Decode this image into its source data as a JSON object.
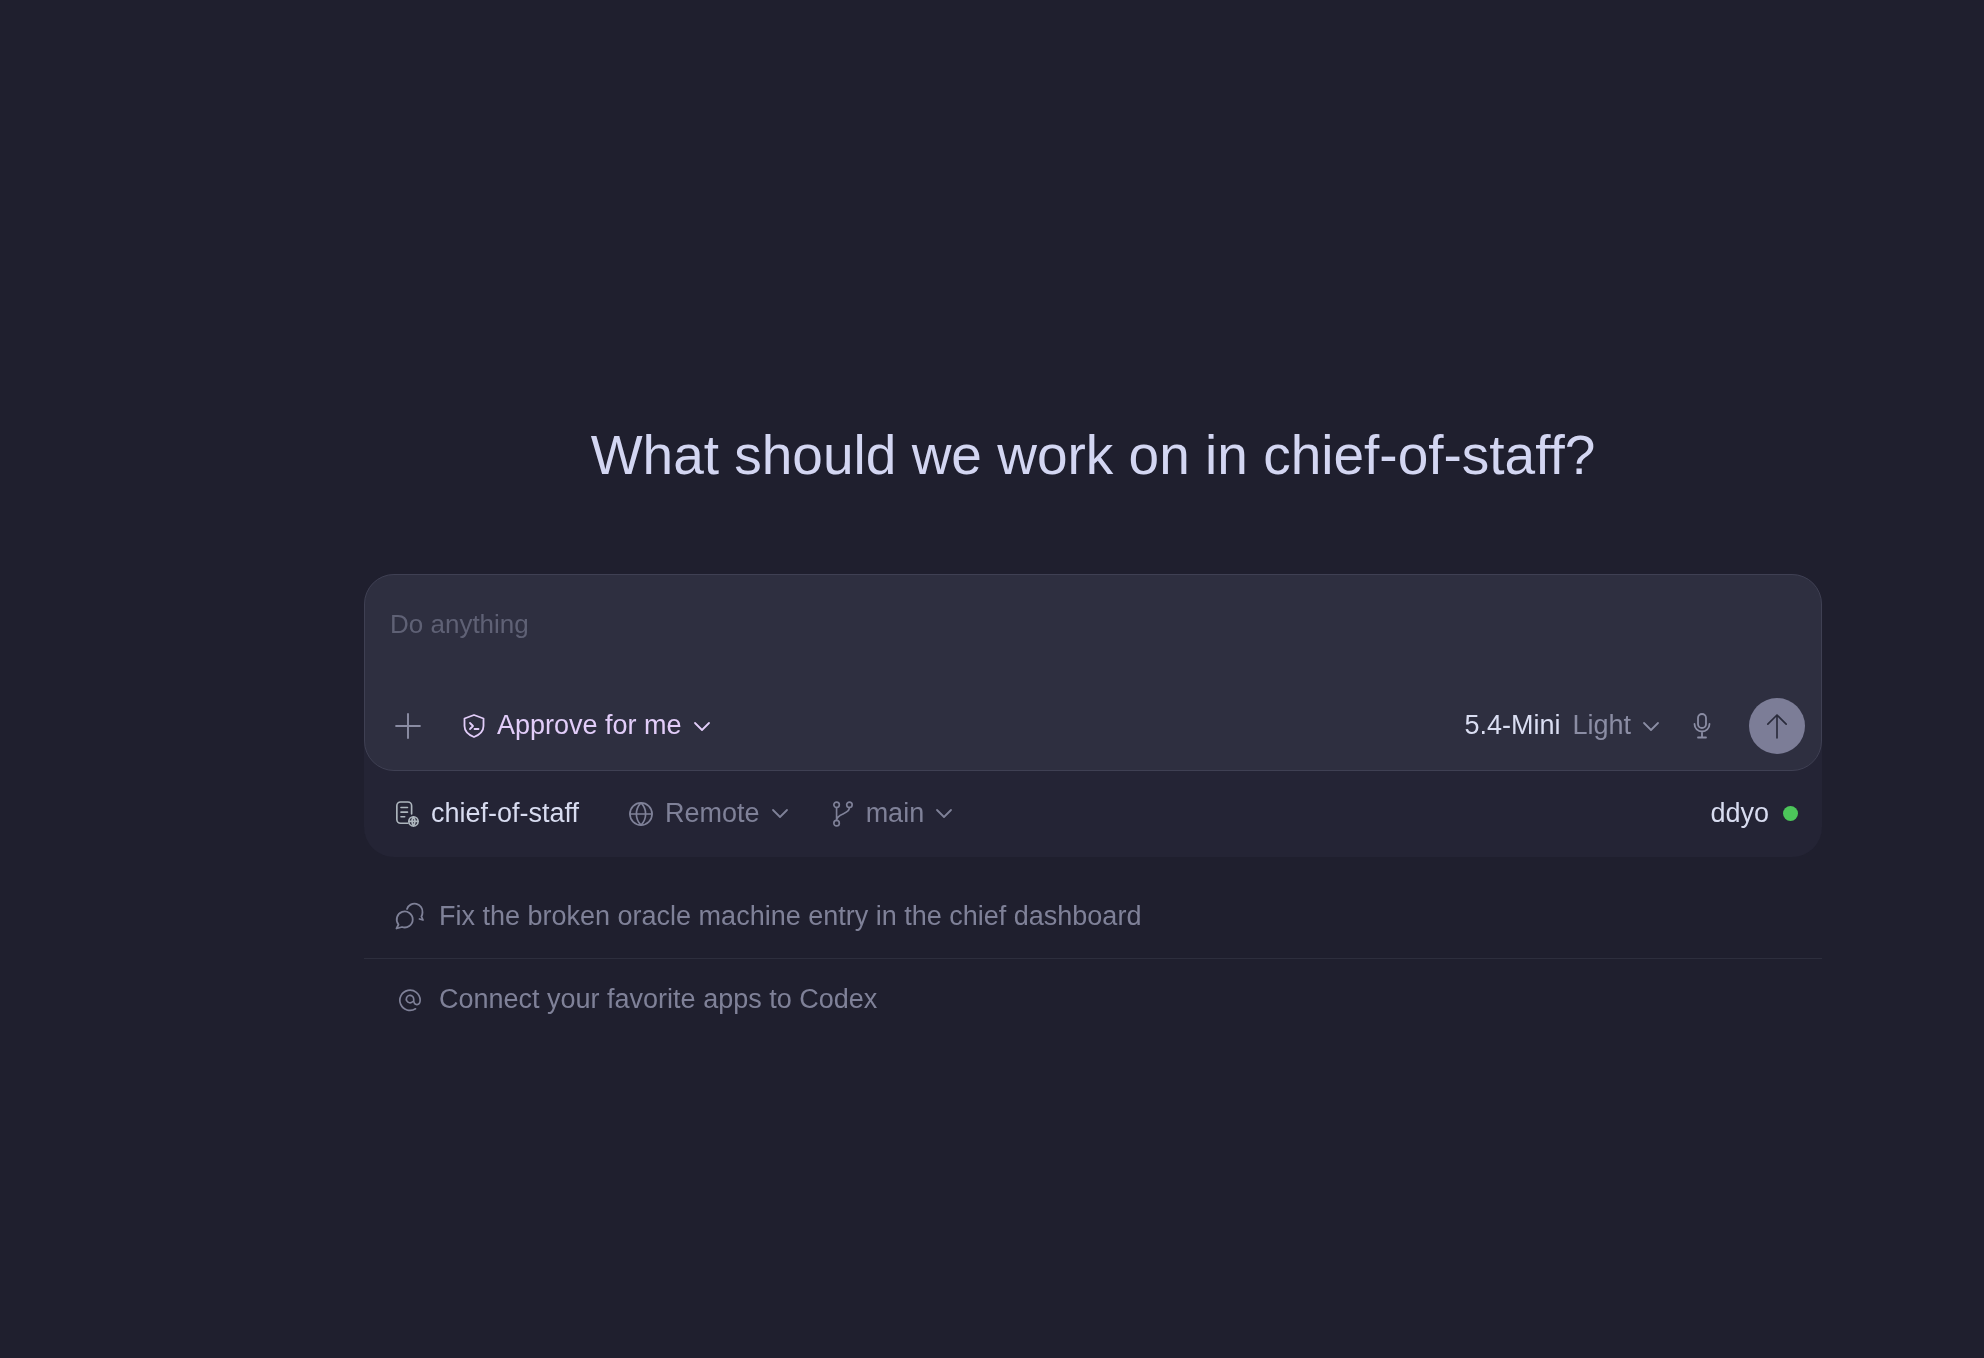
{
  "heading": "What should we work on in chief-of-staff?",
  "composer": {
    "placeholder": "Do anything",
    "permission_menu": {
      "label": "Approve for me"
    },
    "model_menu": {
      "model": "5.4-Mini",
      "reasoning": "Light"
    }
  },
  "context_bar": {
    "project": "chief-of-staff",
    "environment_menu": {
      "label": "Remote"
    },
    "branch_menu": {
      "label": "main"
    },
    "user": {
      "name": "ddyo",
      "online": true
    }
  },
  "suggestions": [
    {
      "kind": "chat",
      "text": "Fix the broken oracle machine entry in the chief dashboard"
    },
    {
      "kind": "connect",
      "text": "Connect your favorite apps to Codex"
    }
  ]
}
